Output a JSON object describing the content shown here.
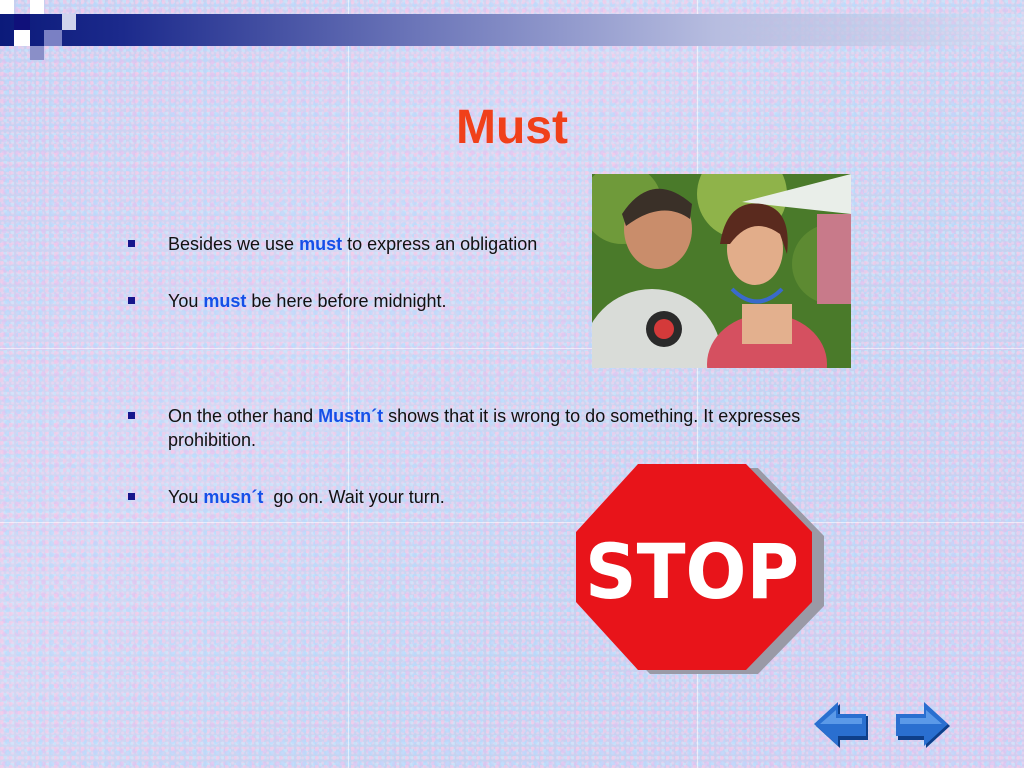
{
  "slide": {
    "title": "Must",
    "bullets": [
      {
        "pre": "Besides we use ",
        "kw": "must",
        "post": " to express an obligation"
      },
      {
        "pre": "You ",
        "kw": "must",
        "post": " be here before midnight."
      },
      {
        "pre": "On the other hand ",
        "kw": "Mustn´t",
        "post": " shows that it is wrong to do something. It expresses prohibition."
      },
      {
        "pre": "You ",
        "kw": "musn´t",
        "post": "  go on. Wait your turn."
      }
    ],
    "stop_sign_text": "STOP"
  },
  "colors": {
    "title": "#f0401a",
    "keyword": "#1550e8",
    "bullet": "#16168c",
    "bar": "#0b1a7a",
    "stop_red": "#e8141a",
    "arrow_blue": "#1f5fbf"
  },
  "icons": {
    "back": "arrow-left-icon",
    "forward": "arrow-right-icon"
  }
}
